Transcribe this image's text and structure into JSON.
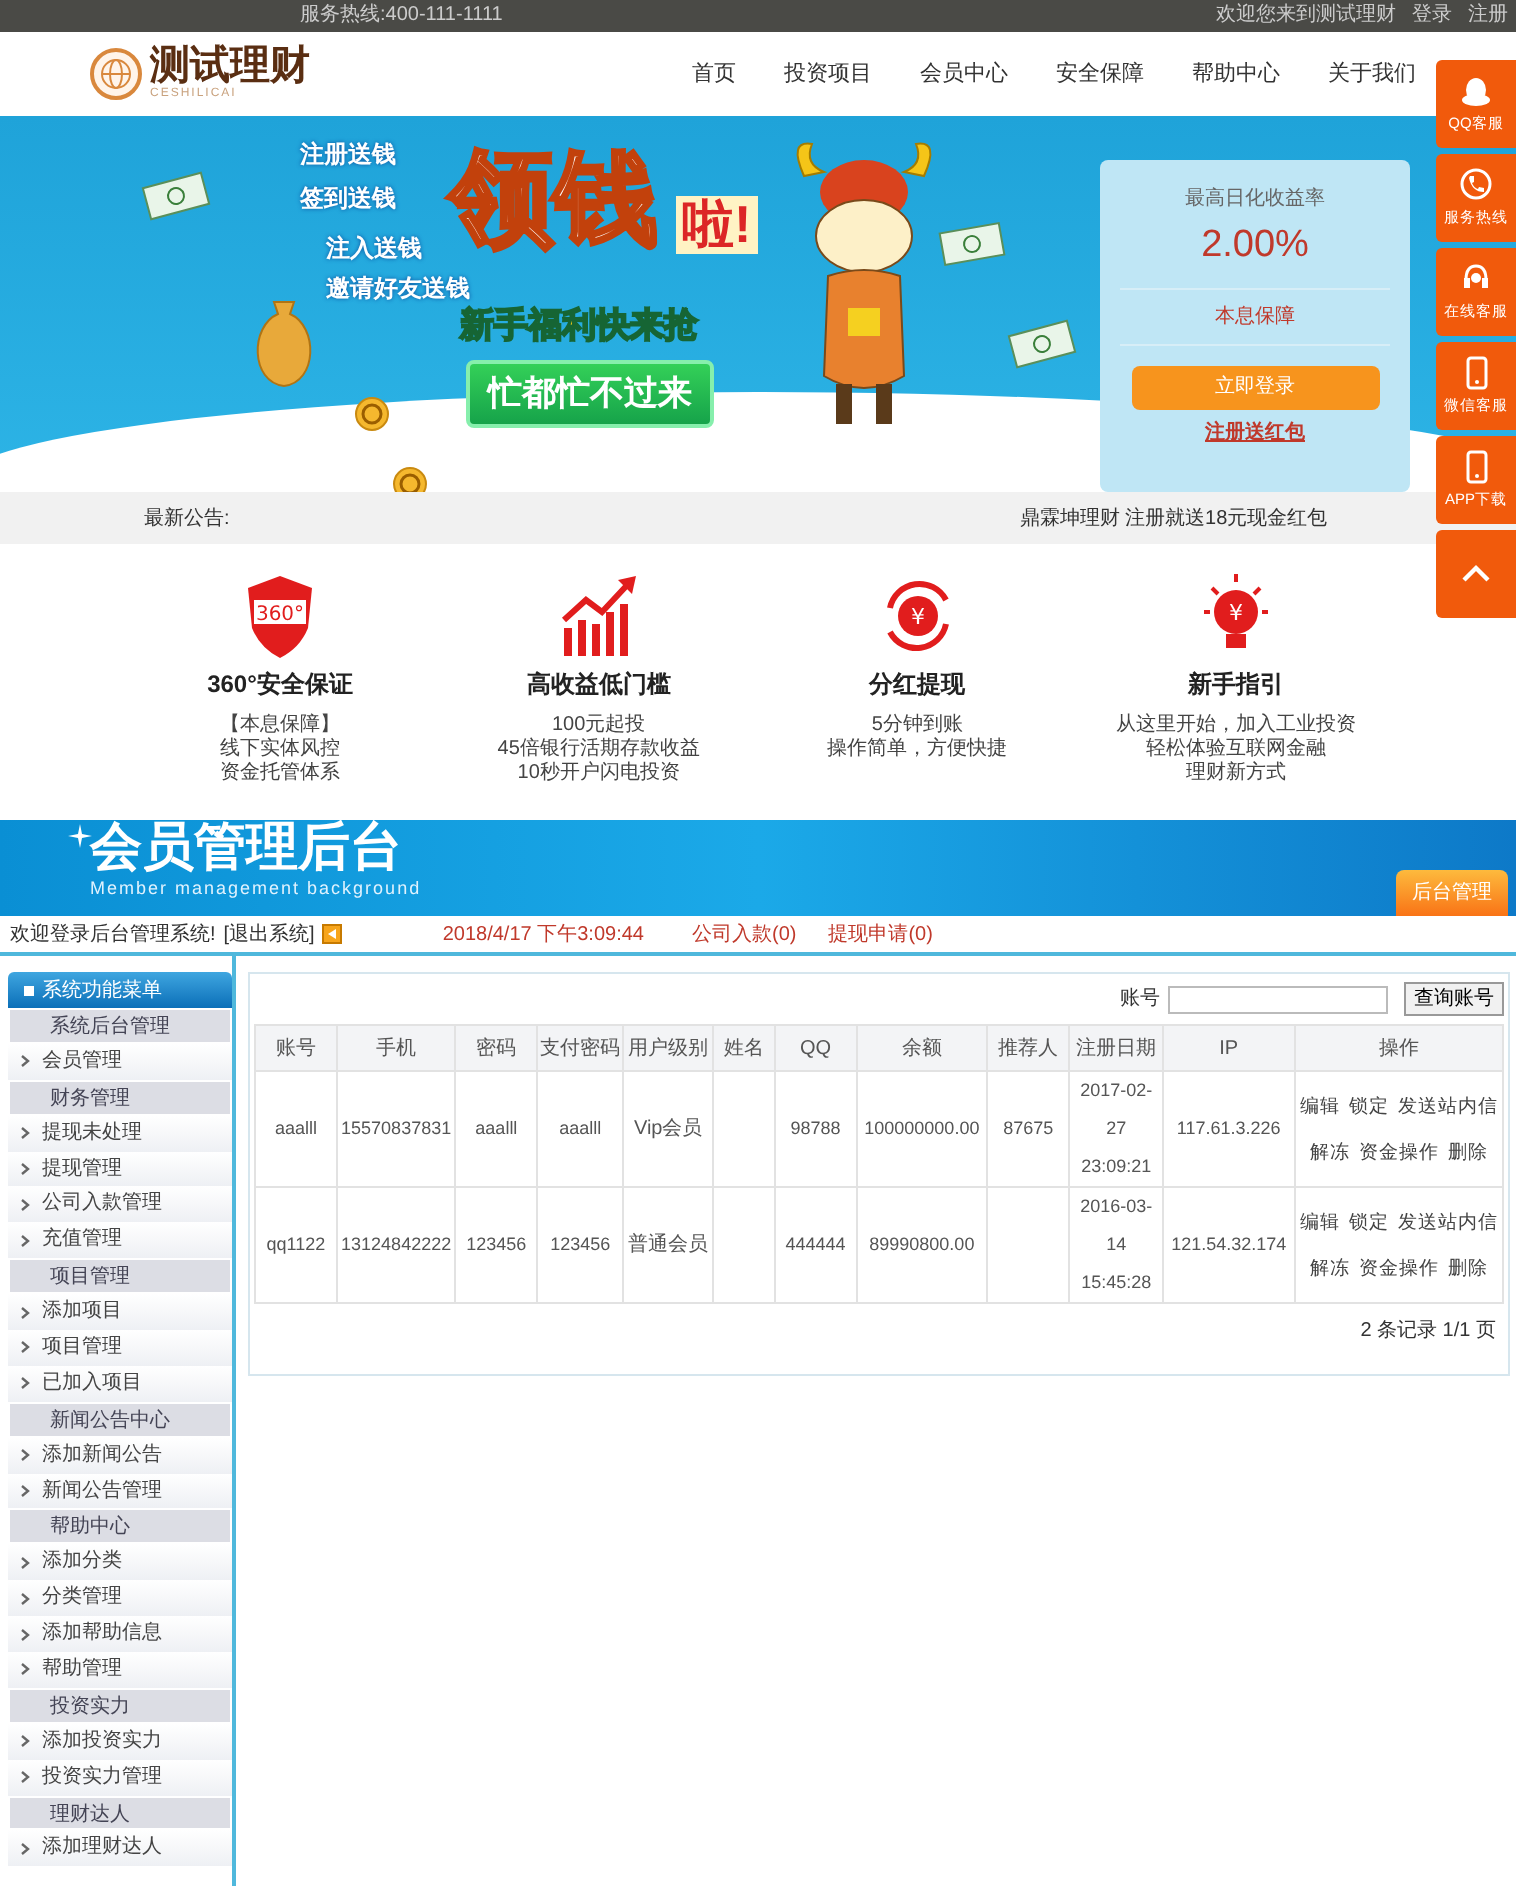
{
  "top_bar": {
    "hotline": "服务热线:400-111-1111",
    "welcome": "欢迎您来到测试理财",
    "login": "登录",
    "register": "注册"
  },
  "logo": {
    "name": "测试理财",
    "subtitle": "CESHILICAI"
  },
  "nav": [
    "首页",
    "投资项目",
    "会员中心",
    "安全保障",
    "帮助中心",
    "关于我们"
  ],
  "banner": {
    "slogans": [
      "注册送钱",
      "签到送钱",
      "注入送钱",
      "邀请好友送钱"
    ],
    "headline": "领钱",
    "exclaim": "啦!",
    "subheadline": "新手福利快来抢",
    "button": "忙都忙不过来"
  },
  "rate_card": {
    "label": "最高日化收益率",
    "rate": "2.00%",
    "guarantee": "本息保障",
    "login_button": "立即登录",
    "register_link": "注册送红包"
  },
  "side_tools": [
    {
      "kind": "qq",
      "label": "QQ客服"
    },
    {
      "kind": "phone",
      "label": "服务热线"
    },
    {
      "kind": "headset",
      "label": "在线客服"
    },
    {
      "kind": "mobile",
      "label": "微信客服"
    },
    {
      "kind": "mobile",
      "label": "APP下载"
    },
    {
      "kind": "top"
    }
  ],
  "notice": {
    "label": "最新公告:",
    "text": "鼎霖坤理财 注册就送18元现金红包"
  },
  "features": [
    {
      "kind": "shield",
      "badge": "360°",
      "title": "360°安全保证",
      "lines": [
        "【本息保障】",
        "线下实体风控",
        "资金托管体系"
      ]
    },
    {
      "kind": "chart",
      "title": "高收益低门槛",
      "lines": [
        "100元起投",
        "45倍银行活期存款收益",
        "10秒开户闪电投资"
      ]
    },
    {
      "kind": "cycle",
      "badge": "¥",
      "title": "分红提现",
      "lines": [
        "5分钟到账",
        "操作简单，方便快捷"
      ]
    },
    {
      "kind": "bulb",
      "badge": "¥",
      "title": "新手指引",
      "lines": [
        "从这里开始，加入工业投资",
        "轻松体验互联网金融",
        "理财新方式"
      ]
    }
  ],
  "admin_header": {
    "title": "会员管理后台",
    "subtitle": "Member management background",
    "tab": "后台管理"
  },
  "status_bar": {
    "welcome": "欢迎登录后台管理系统!",
    "logout": "[退出系统]",
    "datetime": "2018/4/17 下午3:09:44",
    "deposits": "公司入款(0)",
    "withdrawals": "提现申请(0)"
  },
  "sidebar": {
    "title": "系统功能菜单",
    "sections": [
      {
        "label": "系统后台管理",
        "children": [
          {
            "label": "会员管理"
          }
        ]
      },
      {
        "label": "财务管理",
        "children": [
          {
            "label": "提现未处理"
          },
          {
            "label": "提现管理"
          },
          {
            "label": "公司入款管理"
          },
          {
            "label": "充值管理"
          }
        ]
      },
      {
        "label": "项目管理",
        "children": [
          {
            "label": "添加项目"
          },
          {
            "label": "项目管理"
          },
          {
            "label": "已加入项目"
          }
        ]
      },
      {
        "label": "新闻公告中心",
        "children": [
          {
            "label": "添加新闻公告"
          },
          {
            "label": "新闻公告管理"
          }
        ]
      },
      {
        "label": "帮助中心",
        "children": [
          {
            "label": "添加分类"
          },
          {
            "label": "分类管理"
          },
          {
            "label": "添加帮助信息"
          },
          {
            "label": "帮助管理"
          }
        ]
      },
      {
        "label": "投资实力",
        "children": [
          {
            "label": "添加投资实力"
          },
          {
            "label": "投资实力管理"
          }
        ]
      },
      {
        "label": "理财达人",
        "children": [
          {
            "label": "添加理财达人"
          }
        ]
      }
    ]
  },
  "search": {
    "label": "账号",
    "button": "查询账号"
  },
  "table": {
    "columns": [
      "账号",
      "手机",
      "密码",
      "支付密码",
      "用户级别",
      "姓名",
      "QQ",
      "余额",
      "推荐人",
      "注册日期",
      "IP",
      "操作"
    ],
    "rows": [
      {
        "cells": [
          "aaalll",
          "15570837831",
          "aaalll",
          "aaalll",
          "Vip会员",
          "",
          "98788",
          "100000000.00",
          "87675",
          "2017-02-27 23:09:21",
          "117.61.3.226"
        ],
        "actions": [
          "编辑",
          "锁定",
          "发送站内信",
          "解冻",
          "资金操作",
          "删除"
        ]
      },
      {
        "cells": [
          "qq1122",
          "13124842222",
          "123456",
          "123456",
          "普通会员",
          "",
          "444444",
          "89990800.00",
          "",
          "2016-03-14 15:45:28",
          "121.54.32.174"
        ],
        "actions": [
          "编辑",
          "锁定",
          "发送站内信",
          "解冻",
          "资金操作",
          "删除"
        ]
      }
    ]
  },
  "pagination": "2 条记录 1/1 页"
}
